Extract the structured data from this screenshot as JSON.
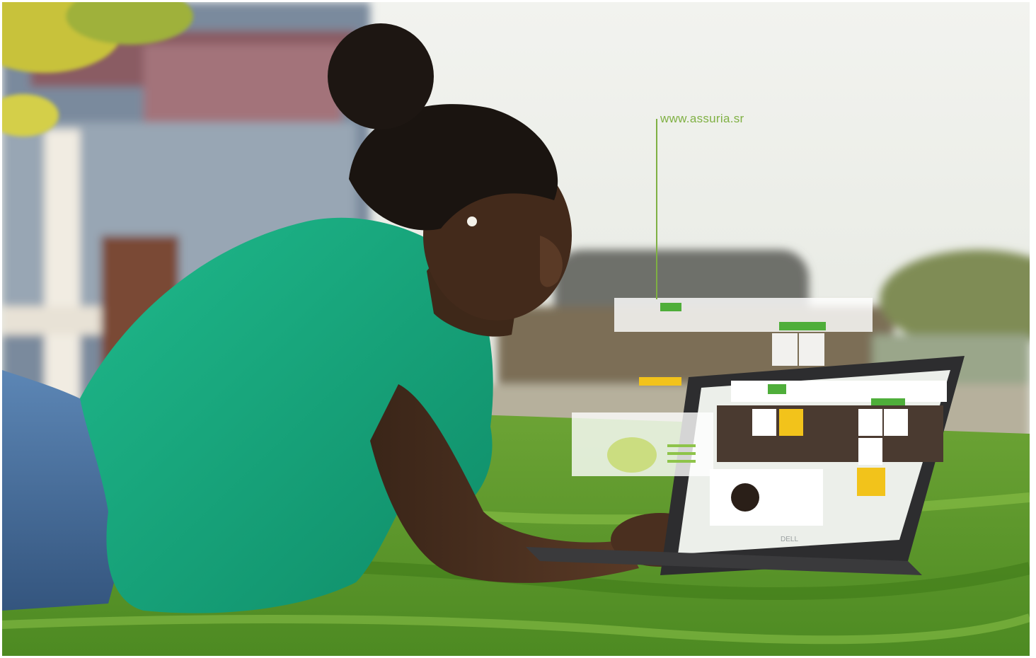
{
  "photo": {
    "caption_url": "www.assuria.sr",
    "laptop_brand": "DELL"
  },
  "colors": {
    "grass": "#5f9a2a",
    "shirt": "#13a47c",
    "sky": "#e9ece6",
    "brand_green": "#4fae3a",
    "brand_yellow": "#f2c31b",
    "caption": "#7fb043"
  },
  "scene": {
    "subject": "woman-lying-on-grass",
    "device": "laptop",
    "overlay": "website-ui-panels"
  }
}
